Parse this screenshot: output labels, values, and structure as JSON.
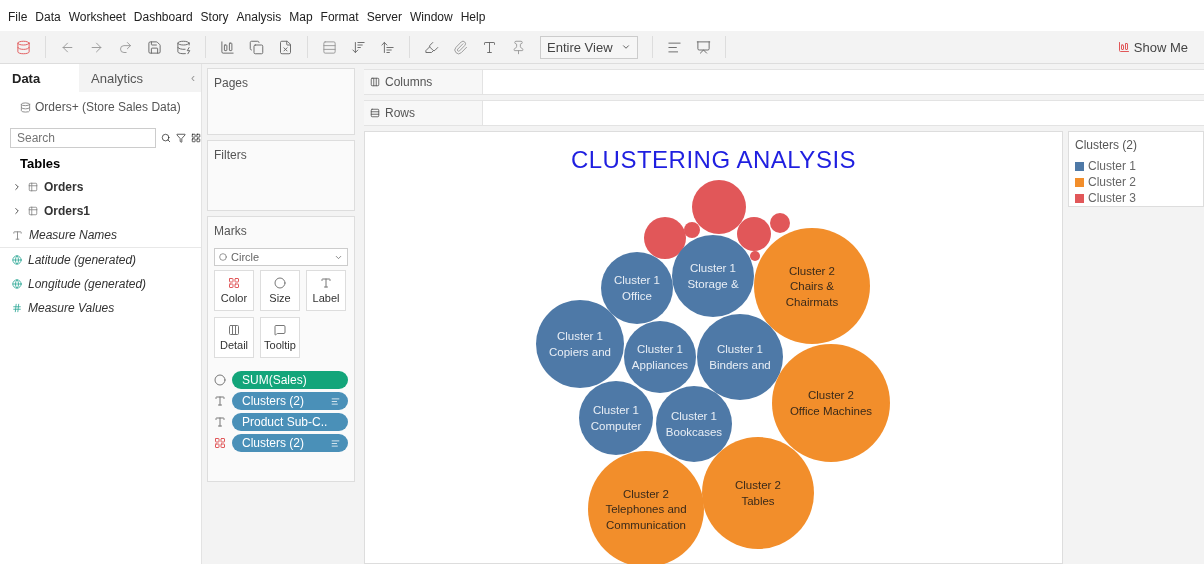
{
  "menu": [
    "File",
    "Data",
    "Worksheet",
    "Dashboard",
    "Story",
    "Analysis",
    "Map",
    "Format",
    "Server",
    "Window",
    "Help"
  ],
  "toolbar": {
    "fit": "Entire View",
    "show_me": "Show Me"
  },
  "data_pane": {
    "tabs": [
      {
        "label": "Data",
        "selected": true
      },
      {
        "label": "Analytics",
        "selected": false
      }
    ],
    "collapse": "‹",
    "source": "Orders+ (Store Sales Data)",
    "search": {
      "placeholder": "Search"
    },
    "section": "Tables",
    "fields": [
      {
        "kind": "table",
        "name": "Orders"
      },
      {
        "kind": "table",
        "name": "Orders1"
      },
      {
        "kind": "dimension",
        "name": "Measure Names"
      },
      {
        "kind": "geo",
        "name": "Latitude (generated)"
      },
      {
        "kind": "geo",
        "name": "Longitude (generated)"
      },
      {
        "kind": "measure",
        "name": "Measure Values"
      }
    ]
  },
  "cards": {
    "pages": "Pages",
    "filters": "Filters",
    "marks": {
      "title": "Marks",
      "mark_type": "Circle",
      "buttons": [
        {
          "kind": "color",
          "label": "Color"
        },
        {
          "kind": "size",
          "label": "Size"
        },
        {
          "kind": "label",
          "label": "Label"
        },
        {
          "kind": "detail",
          "label": "Detail"
        },
        {
          "kind": "tooltip",
          "label": "Tooltip"
        }
      ],
      "pills": [
        {
          "kind": "size",
          "measure": true,
          "label": "SUM(Sales)",
          "sorted": false
        },
        {
          "kind": "label",
          "measure": false,
          "label": "Clusters (2)",
          "sorted": true
        },
        {
          "kind": "label",
          "measure": false,
          "label": "Product Sub-C..",
          "sorted": false
        },
        {
          "kind": "color",
          "measure": false,
          "label": "Clusters (2)",
          "sorted": true
        }
      ]
    }
  },
  "shelves": [
    {
      "kind": "columns",
      "label": "Columns"
    },
    {
      "kind": "rows",
      "label": "Rows"
    }
  ],
  "view": {
    "title": "CLUSTERING ANALYSIS",
    "bubbles": [
      {
        "color": "#e15759"
      },
      {
        "color": "#e15759"
      },
      {
        "color": "#e15759"
      },
      {
        "color": "#e15759"
      },
      {
        "color": "#e15759"
      },
      {
        "color": "#e15759"
      },
      {
        "color": "#4e79a7",
        "lines": [
          "Cluster 1",
          "Office"
        ]
      },
      {
        "color": "#4e79a7",
        "lines": [
          "Cluster 1",
          "Storage &"
        ]
      },
      {
        "color": "#f28e2b",
        "lines": [
          "Cluster 2",
          "Chairs &",
          "Chairmats"
        ]
      },
      {
        "color": "#4e79a7",
        "lines": [
          "Cluster 1",
          "Copiers and"
        ]
      },
      {
        "color": "#4e79a7",
        "lines": [
          "Cluster 1",
          "Appliances"
        ]
      },
      {
        "color": "#4e79a7",
        "lines": [
          "Cluster 1",
          "Binders and"
        ]
      },
      {
        "color": "#f28e2b",
        "lines": [
          "Cluster 2",
          "Office Machines"
        ]
      },
      {
        "color": "#4e79a7",
        "lines": [
          "Cluster 1",
          "Computer"
        ]
      },
      {
        "color": "#4e79a7",
        "lines": [
          "Cluster 1",
          "Bookcases"
        ]
      },
      {
        "color": "#f28e2b",
        "lines": [
          "Cluster 2",
          "Telephones and",
          "Communication"
        ]
      },
      {
        "color": "#f28e2b",
        "lines": [
          "Cluster 2",
          "Tables"
        ]
      }
    ]
  },
  "legend": {
    "title": "Clusters (2)",
    "items": [
      {
        "label": "Cluster 1",
        "color": "#4e79a7"
      },
      {
        "label": "Cluster 2",
        "color": "#f28e2b"
      },
      {
        "label": "Cluster 3",
        "color": "#e15759"
      }
    ]
  }
}
